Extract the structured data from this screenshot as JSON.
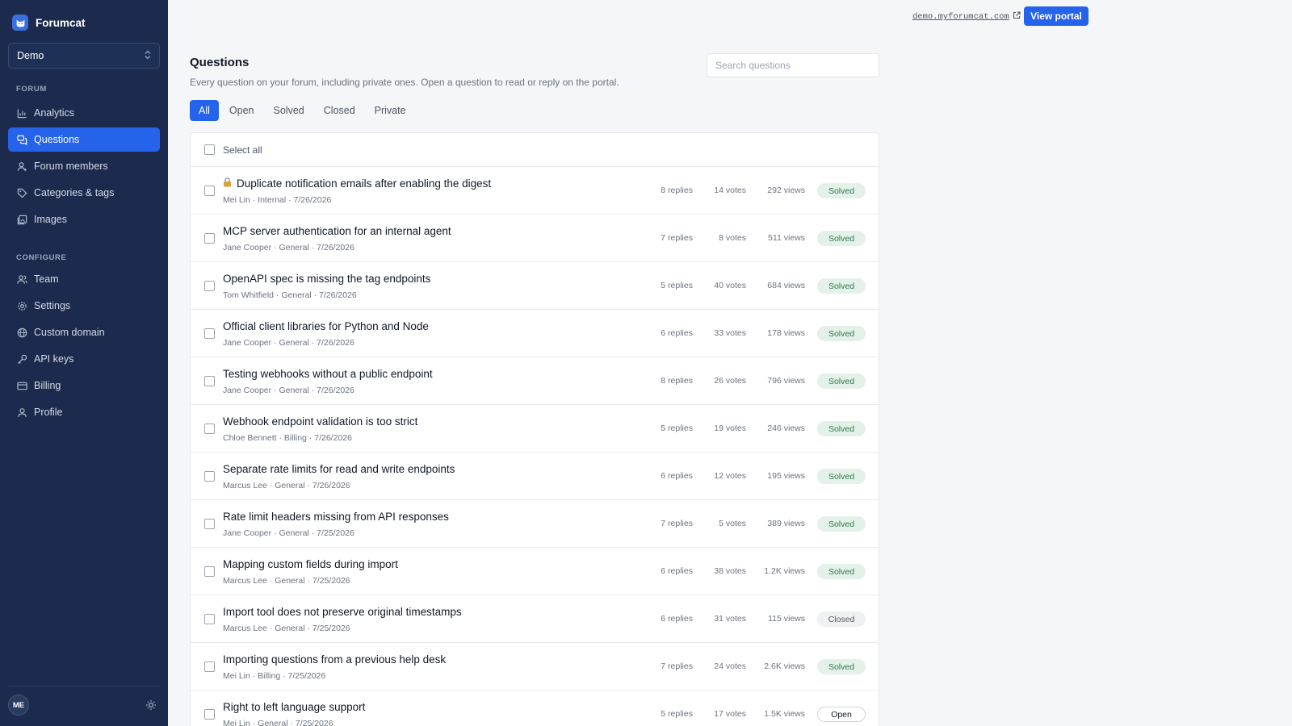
{
  "app": {
    "name": "Forumcat",
    "workspace": "Demo"
  },
  "sidebar": {
    "forum_label": "FORUM",
    "configure_label": "CONFIGURE",
    "forum_items": [
      {
        "label": "Analytics",
        "icon": "analytics-icon"
      },
      {
        "label": "Questions",
        "icon": "questions-icon",
        "active": true
      },
      {
        "label": "Forum members",
        "icon": "members-icon"
      },
      {
        "label": "Categories & tags",
        "icon": "tag-icon"
      },
      {
        "label": "Images",
        "icon": "images-icon"
      }
    ],
    "configure_items": [
      {
        "label": "Team",
        "icon": "team-icon"
      },
      {
        "label": "Settings",
        "icon": "gear-icon"
      },
      {
        "label": "Custom domain",
        "icon": "globe-icon"
      },
      {
        "label": "API keys",
        "icon": "key-icon"
      },
      {
        "label": "Billing",
        "icon": "card-icon"
      },
      {
        "label": "Profile",
        "icon": "user-icon"
      }
    ],
    "user_initials": "ME"
  },
  "topbar": {
    "domain": "demo.myforumcat.com",
    "view_portal": "View portal"
  },
  "header": {
    "title": "Questions",
    "subtitle": "Every question on your forum, including private ones. Open a question to read or reply on the portal.",
    "search_placeholder": "Search questions"
  },
  "tabs": [
    {
      "label": "All",
      "active": true
    },
    {
      "label": "Open"
    },
    {
      "label": "Solved"
    },
    {
      "label": "Closed"
    },
    {
      "label": "Private"
    }
  ],
  "list": {
    "select_all": "Select all",
    "rows": [
      {
        "title": "Duplicate notification emails after enabling the digest",
        "locked": true,
        "meta": "Mei Lin · Internal · 7/26/2026",
        "replies": "8 replies",
        "votes": "14 votes",
        "views": "292 views",
        "status": "Solved"
      },
      {
        "title": "MCP server authentication for an internal agent",
        "meta": "Jane Cooper · General · 7/26/2026",
        "replies": "7 replies",
        "votes": "8 votes",
        "views": "511 views",
        "status": "Solved"
      },
      {
        "title": "OpenAPI spec is missing the tag endpoints",
        "meta": "Tom Whitfield · General · 7/26/2026",
        "replies": "5 replies",
        "votes": "40 votes",
        "views": "684 views",
        "status": "Solved"
      },
      {
        "title": "Official client libraries for Python and Node",
        "meta": "Jane Cooper · General · 7/26/2026",
        "replies": "6 replies",
        "votes": "33 votes",
        "views": "178 views",
        "status": "Solved"
      },
      {
        "title": "Testing webhooks without a public endpoint",
        "meta": "Jane Cooper · General · 7/26/2026",
        "replies": "8 replies",
        "votes": "26 votes",
        "views": "796 views",
        "status": "Solved"
      },
      {
        "title": "Webhook endpoint validation is too strict",
        "meta": "Chloe Bennett · Billing · 7/26/2026",
        "replies": "5 replies",
        "votes": "19 votes",
        "views": "246 views",
        "status": "Solved"
      },
      {
        "title": "Separate rate limits for read and write endpoints",
        "meta": "Marcus Lee · General · 7/26/2026",
        "replies": "6 replies",
        "votes": "12 votes",
        "views": "195 views",
        "status": "Solved"
      },
      {
        "title": "Rate limit headers missing from API responses",
        "meta": "Jane Cooper · General · 7/25/2026",
        "replies": "7 replies",
        "votes": "5 votes",
        "views": "389 views",
        "status": "Solved"
      },
      {
        "title": "Mapping custom fields during import",
        "meta": "Marcus Lee · General · 7/25/2026",
        "replies": "6 replies",
        "votes": "38 votes",
        "views": "1.2K views",
        "status": "Solved"
      },
      {
        "title": "Import tool does not preserve original timestamps",
        "meta": "Marcus Lee · General · 7/25/2026",
        "replies": "6 replies",
        "votes": "31 votes",
        "views": "115 views",
        "status": "Closed"
      },
      {
        "title": "Importing questions from a previous help desk",
        "meta": "Mei Lin · Billing · 7/25/2026",
        "replies": "7 replies",
        "votes": "24 votes",
        "views": "2.6K views",
        "status": "Solved"
      },
      {
        "title": "Right to left language support",
        "meta": "Mei Lin · General · 7/25/2026",
        "replies": "5 replies",
        "votes": "17 votes",
        "views": "1.5K views",
        "status": "Open"
      }
    ]
  },
  "colors": {
    "sidebar_bg": "#1c2b4d",
    "accent": "#2563eb",
    "solved_bg": "#e3f1e8",
    "solved_text": "#2f7a4c"
  }
}
